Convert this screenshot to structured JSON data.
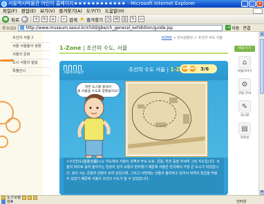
{
  "window": {
    "title": "서울역사박물관 어린이 홈페이지★★★★★★★★★★★★ - Microsoft Internet Explorer",
    "controls": [
      "_",
      "□",
      "×"
    ]
  },
  "menu": [
    "파일(F)",
    "편집(E)",
    "보기(V)",
    "즐겨찾기(A)",
    "도구(T)",
    "도움말(H)"
  ],
  "toolbar": {
    "back_label": "뒤로",
    "search_label": "검색",
    "favorites_label": "즐겨찾기"
  },
  "address": {
    "label": "주소(D)",
    "url": "http://www.museum.seoul.kr/child/gbe/ch_general_exhibition/guide.jsp",
    "go_label": "이동",
    "links_label": "연결"
  },
  "subnav": {
    "items": [
      "조선의 서울 2",
      "서울 사람들의 생활",
      "서울의 문화",
      "도시 서울의 발달",
      "특별전시"
    ]
  },
  "breadcrumb": {
    "home": "HOME",
    "rest": "> 전시실정보 > 조선의 수도 서울"
  },
  "heading": {
    "zone": "1-Zone",
    "title": "조선의 수도, 서울"
  },
  "panel": {
    "logo_text": "서울역사박물관",
    "title": "조선의 수도 서울",
    "zone": "1-Zone",
    "page": "3/6",
    "bubble": "많은 도시를 중에서\n왜 서울을 수도로 정했을까요?",
    "body": "<수선전도(首善全圖)>는 지도에서 서울의 성벽과 주요 도로, 궁궐, 하천 등을 자세히 그린 지도입니다. 서울의 바다로 흘러 들어가는 한강이 있어 교통이 편리했기 때문에 서울은 한국에서 가장 큰 도시가 되었습니다. 왕이 사는 궁궐과 관청이 모여 있었으며, 그리고 사방에는 산들이 둘러싸고 있어서 외적의 침입을 막을 수 있었기 때문에 서울이 조선의 수도가 될 수 있었습니다."
  },
  "rail": {
    "badge": "바로가기",
    "items": [
      "서울이야기",
      "관람 안내",
      "게시판",
      "자료실"
    ]
  },
  "bottombar": {
    "label": "도구모음"
  },
  "status": {
    "left": "완료",
    "zone": "인터넷"
  },
  "colors": {
    "titlebar": "#1458d0",
    "panel": "#2f9fd6",
    "heading_green": "#2f7a2f",
    "accent_orange": "#f2a12a"
  }
}
